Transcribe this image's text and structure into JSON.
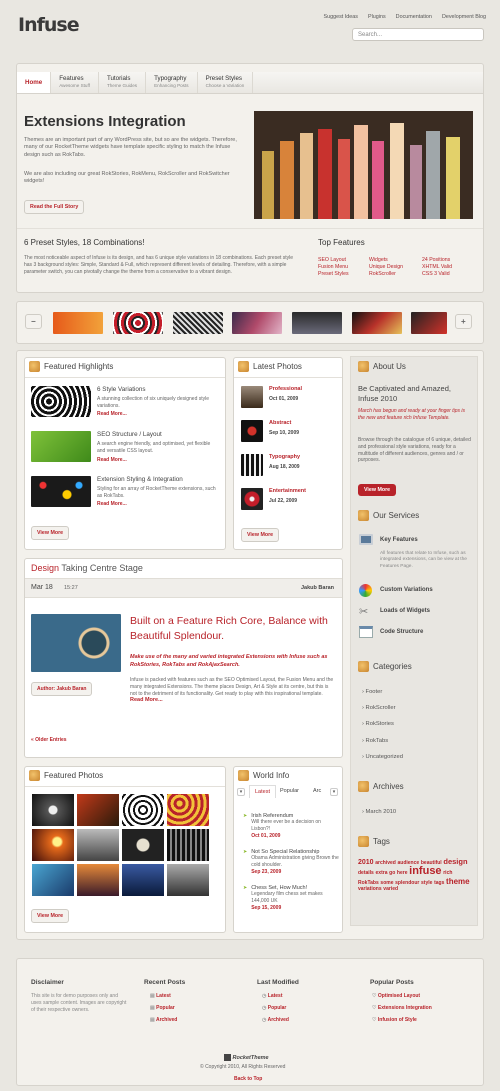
{
  "logo": "Infuse",
  "toplinks": [
    "Suggest Ideas",
    "Plugins",
    "Documentation",
    "Development Blog"
  ],
  "search": {
    "placeholder": "Search..."
  },
  "nav": [
    {
      "label": "Home",
      "sub": ""
    },
    {
      "label": "Features",
      "sub": "Awesome Stuff"
    },
    {
      "label": "Tutorials",
      "sub": "Theme Guides"
    },
    {
      "label": "Typography",
      "sub": "Enhancing Posts"
    },
    {
      "label": "Preset Styles",
      "sub": "Choose a Variation"
    }
  ],
  "hero": {
    "title": "Extensions Integration",
    "p1": "Themes are an important part of any WordPress site, but so are the widgets. Therefore, many of our RocketTheme widgets have template specific styling to match the Infuse design such as RokTabs.",
    "p2": "We are also including our great RokStories, RokMenu, RokScroller and RokSwitcher widgets!",
    "button": "Read the Full Story"
  },
  "presets": {
    "title": "6 Preset Styles, 18 Combinations!",
    "text": "The most noticeable aspect of Infuse is its design, and has 6 unique style variations in 18 combinations. Each preset style has 3 background styles: Simple, Standard & Full, which represent different levels of detailing. Therefore, with a simple parameter switch, you can pivotally change the theme from a conservative to a vibrant design."
  },
  "top_features": {
    "title": "Top Features",
    "items": [
      "SEO Layout",
      "Widgets",
      "24 Positions",
      "Fusion Menu",
      "Unique Design",
      "XHTML Valid",
      "Preset Styles",
      "RokScroller",
      "CSS 3 Valid"
    ]
  },
  "scroller": {
    "prev": "−",
    "next": "+"
  },
  "featured": {
    "title": "Featured Highlights",
    "items": [
      {
        "title": "6 Style Variations",
        "text": "A stunning collection of six uniquely designed style variations.",
        "more": "Read More..."
      },
      {
        "title": "SEO Structure / Layout",
        "text": "A search engine friendly, and optimised, yet flexible and versatile CSS layout.",
        "more": "Read More..."
      },
      {
        "title": "Extension Styling & Integration",
        "text": "Styling for an array of RocketTheme extensions, such as RokTabs.",
        "more": "Read More..."
      }
    ],
    "button": "View More"
  },
  "latest_photos": {
    "title": "Latest Photos",
    "items": [
      {
        "title": "Professional",
        "date": "Oct 01, 2009"
      },
      {
        "title": "Abstract",
        "date": "Sep 10, 2009"
      },
      {
        "title": "Typography",
        "date": "Aug 18, 2009"
      },
      {
        "title": "Entertainment",
        "date": "Jul 22, 2009"
      }
    ],
    "button": "View More"
  },
  "about": {
    "title": "About Us",
    "heading": "Be Captivated and Amazed, Infuse 2010",
    "italic": "March has begun and ready at your finger tips is the new and feature rich Infuse Template.",
    "text": "Browse through the catalogue of 6 unique, detailed and professional style variations, ready for a multitude of different audiences, genres and / or purposes.",
    "button": "View More"
  },
  "services": {
    "title": "Our Services",
    "items": [
      {
        "title": "Key Features",
        "text": "All features that relate to Infuse, such as integrated extensions, can be view at the Features Page."
      },
      {
        "title": "Custom Variations",
        "text": ""
      },
      {
        "title": "Loads of Widgets",
        "text": ""
      },
      {
        "title": "Code Structure",
        "text": ""
      }
    ]
  },
  "categories": {
    "title": "Categories",
    "items": [
      "Footer",
      "RokScroller",
      "RokStories",
      "RokTabs",
      "Uncategorized"
    ]
  },
  "archives": {
    "title": "Archives",
    "items": [
      "March 2010"
    ]
  },
  "tags": {
    "title": "Tags",
    "words": [
      "2010",
      "archived",
      "audience",
      "beautiful",
      "design",
      "details",
      "extra",
      "go",
      "here",
      "infuse",
      "rich",
      "RokTabs",
      "some",
      "splendour",
      "style",
      "tags",
      "theme",
      "variations",
      "varied"
    ]
  },
  "post": {
    "cat_red": "Design",
    "cat_rest": "Taking Centre Stage",
    "date": "Mar 18",
    "time": "15:27",
    "author_top": "Jakub Baran",
    "title": "Built on a Feature Rich Core, Balance with Beautiful Splendour.",
    "lead": "Make use of the many and varied integrated Extensions with Infuse such as RokStories, RokTabs and RokAjaxSearch.",
    "author": "Author: Jakub Baran",
    "text": "Infuse is packed with features such as the SEO Optimised Layout, the Fusion Menu and the many integrated Extensions. The theme places Design, Art & Style at its centre, but this is not to the detriment of its functionality. Get ready to play with this inspirational template.",
    "more": "Read More...",
    "older": "« Older Entries"
  },
  "featured_photos": {
    "title": "Featured Photos",
    "button": "View More"
  },
  "world": {
    "title": "World Info",
    "tabs": [
      "Latest",
      "Popular",
      "Arc"
    ],
    "items": [
      {
        "title": "Irish Referendum",
        "text": "Will there ever be a decision on Lisbon?!",
        "date": "Oct 01, 2009"
      },
      {
        "title": "Not So Special Relationship",
        "text": "Obama Administration giving Brown the cold shoulder.",
        "date": "Sep 23, 2009"
      },
      {
        "title": "Chess Set, How Much!",
        "text": "Legendary film chess set makes 144,000 UK",
        "date": "Sep 15, 2009"
      }
    ]
  },
  "footer": {
    "disclaimer_title": "Disclaimer",
    "disclaimer": "This site is for demo purposes only and uses sample content. Images are copyright of their respective owners.",
    "recent_title": "Recent Posts",
    "recent": [
      "Latest",
      "Popular",
      "Archived"
    ],
    "modified_title": "Last Modified",
    "modified": [
      "Latest",
      "Popular",
      "Archived"
    ],
    "popular_title": "Popular Posts",
    "popular": [
      "Optimised Layout",
      "Extensions Integration",
      "Infusion of Style"
    ],
    "brand": "RocketTheme",
    "copyright": "© Copyright 2010, All Rights Reserved",
    "top": "Back to Top"
  }
}
